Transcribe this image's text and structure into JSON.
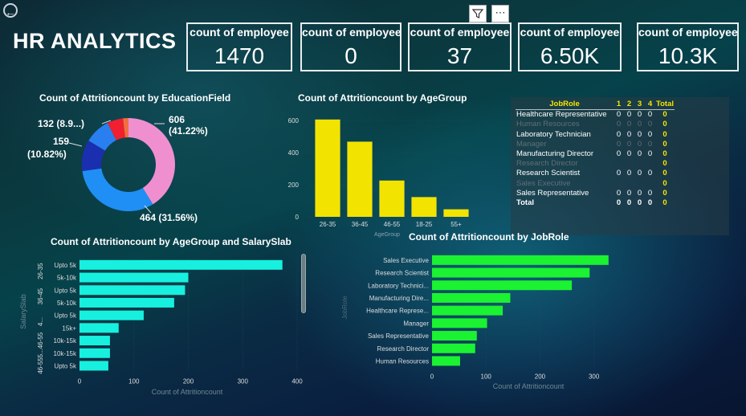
{
  "header": {
    "title": "HR ANALYTICS",
    "filter_icon": "filter-icon",
    "more_icon": "more-options-icon",
    "more_label": "⋯",
    "back_icon": "back-arrow-icon",
    "back_label": "←"
  },
  "kpis": [
    {
      "label": "count of employee",
      "value": "1470"
    },
    {
      "label": "count of employee",
      "value": "0"
    },
    {
      "label": "count of employee",
      "value": "37"
    },
    {
      "label": "count of employee",
      "value": "6.50K"
    },
    {
      "label": "count of employee",
      "value": "10.3K"
    }
  ],
  "colors": {
    "yellow": "#f2e400",
    "cyan": "#17f0de",
    "green": "#1bf232",
    "donut": [
      "#f08fd0",
      "#1f8ff5",
      "#1a2fb0",
      "#2a7ff0",
      "#f02030",
      "#f07040"
    ]
  },
  "chart_data": [
    {
      "type": "pie",
      "title": "Count of Attritioncount by EducationField",
      "slices": [
        {
          "value": 606,
          "label": "606",
          "pct": "(41.22%)"
        },
        {
          "value": 464,
          "label": "464 (31.56%)"
        },
        {
          "value": 159,
          "label": "159",
          "pct": "(10.82%)"
        },
        {
          "value": 132,
          "label": "132 (8.9...)"
        },
        {
          "value": 81
        },
        {
          "value": 28
        }
      ]
    },
    {
      "type": "bar",
      "title": "Count of Attritioncount by AgeGroup",
      "categories": [
        "26-35",
        "36-45",
        "46-55",
        "18-25",
        "55+"
      ],
      "values": [
        606,
        468,
        226,
        123,
        47
      ],
      "xlabel": "AgeGroup",
      "ylim": [
        0,
        650
      ],
      "yticks": [
        0,
        200,
        400,
        600
      ]
    },
    {
      "type": "bar",
      "orientation": "horizontal",
      "title": "Count of Attritioncount by AgeGroup and SalarySlab",
      "groups": [
        {
          "label": "26-35",
          "start": 0,
          "count": 2
        },
        {
          "label": "36-45",
          "start": 2,
          "count": 2
        },
        {
          "label": "4...",
          "start": 4,
          "count": 2
        },
        {
          "label": "46-55",
          "start": 6,
          "count": 1
        },
        {
          "label": "5...",
          "start": 7,
          "count": 1
        },
        {
          "label": "46-55",
          "start": 8,
          "count": 1
        }
      ],
      "categories": [
        "Upto 5k",
        "5k-10k",
        "Upto 5k",
        "5k-10k",
        "Upto 5k",
        "15k+",
        "10k-15k",
        "10k-15k",
        "Upto 5k"
      ],
      "values": [
        373,
        200,
        194,
        174,
        118,
        72,
        56,
        56,
        53
      ],
      "xlabel": "Count of Attritioncount",
      "ylabel": "SalarySlab",
      "xlim": [
        0,
        400
      ],
      "xticks": [
        0,
        100,
        200,
        300,
        400
      ]
    },
    {
      "type": "bar",
      "orientation": "horizontal",
      "title": "Count of Attritioncount by JobRole",
      "categories": [
        "Sales Executive",
        "Research Scientist",
        "Laboratory Technici...",
        "Manufacturing Dire...",
        "Healthcare Represe...",
        "Manager",
        "Sales Representative",
        "Research Director",
        "Human Resources"
      ],
      "values": [
        327,
        292,
        259,
        145,
        131,
        102,
        83,
        80,
        52
      ],
      "xlabel": "Count of Attritioncount",
      "ylabel": "JobRole",
      "xlim": [
        0,
        360
      ],
      "xticks": [
        0,
        100,
        200,
        300
      ]
    }
  ],
  "matrix": {
    "headers": [
      "JobRole",
      "1",
      "2",
      "3",
      "4",
      "Total"
    ],
    "rows": [
      {
        "label": "Healthcare Representative",
        "cells": [
          "0",
          "0",
          "0",
          "0"
        ],
        "total": "0",
        "dim": false
      },
      {
        "label": "Human Resources",
        "cells": [
          "0",
          "0",
          "0",
          "0"
        ],
        "total": "0",
        "dim": true
      },
      {
        "label": "Laboratory Technician",
        "cells": [
          "0",
          "0",
          "0",
          "0"
        ],
        "total": "0",
        "dim": false
      },
      {
        "label": "Manager",
        "cells": [
          "0",
          "0",
          "0",
          "0"
        ],
        "total": "0",
        "dim": true
      },
      {
        "label": "Manufacturing Director",
        "cells": [
          "0",
          "0",
          "0",
          "0"
        ],
        "total": "0",
        "dim": false
      },
      {
        "label": "Research Director",
        "cells": [
          "",
          "",
          "",
          ""
        ],
        "total": "0",
        "dim": true
      },
      {
        "label": "Research Scientist",
        "cells": [
          "0",
          "0",
          "0",
          "0"
        ],
        "total": "0",
        "dim": false
      },
      {
        "label": "Sales Executive",
        "cells": [
          "",
          "",
          "",
          ""
        ],
        "total": "0",
        "dim": true
      },
      {
        "label": "Sales Representative",
        "cells": [
          "0",
          "0",
          "0",
          "0"
        ],
        "total": "0",
        "dim": false
      },
      {
        "label": "Total",
        "cells": [
          "0",
          "0",
          "0",
          "0"
        ],
        "total": "0",
        "dim": false
      }
    ]
  }
}
